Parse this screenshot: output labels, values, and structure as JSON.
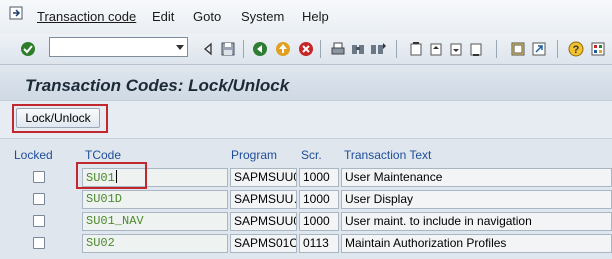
{
  "menu": {
    "items": [
      {
        "label": "Transaction code",
        "accel_index": 0
      },
      {
        "label": "Edit",
        "accel_index": 0
      },
      {
        "label": "Goto",
        "accel_index": 0
      },
      {
        "label": "System",
        "accel_index": 0
      },
      {
        "label": "Help",
        "accel_index": 0
      }
    ]
  },
  "toolbar": {
    "command_value": "",
    "icons": [
      "enter-icon",
      "back-nav-icon",
      "save-icon",
      "back-icon",
      "exit-icon",
      "cancel-icon",
      "print-icon",
      "find-icon",
      "find-next-icon",
      "first-page-icon",
      "previous-page-icon",
      "next-page-icon",
      "last-page-icon",
      "create-session-icon",
      "shortcut-icon",
      "help-icon",
      "customize-layout-icon"
    ]
  },
  "title": "Transaction Codes: Lock/Unlock",
  "app_toolbar": {
    "lock_unlock_label": "Lock/Unlock"
  },
  "table": {
    "headers": {
      "locked": "Locked",
      "tcode": "TCode",
      "program": "Program",
      "screen": "Scr.",
      "text": "Transaction Text"
    },
    "rows": [
      {
        "locked": false,
        "tcode": "SU01",
        "program": "SAPMSUU0",
        "screen": "1000",
        "text": "User Maintenance"
      },
      {
        "locked": false,
        "tcode": "SU01D",
        "program": "SAPMSUU…",
        "screen": "1000",
        "text": "User Display"
      },
      {
        "locked": false,
        "tcode": "SU01_NAV",
        "program": "SAPMSUU0",
        "screen": "1000",
        "text": "User maint. to include in navigation"
      },
      {
        "locked": false,
        "tcode": "SU02",
        "program": "SAPMS01C",
        "screen": "0113",
        "text": "Maintain Authorization Profiles"
      }
    ]
  },
  "colors": {
    "header_text": "#1f4e97",
    "tcode_text": "#4d8a2d",
    "highlight": "#c0282d"
  }
}
